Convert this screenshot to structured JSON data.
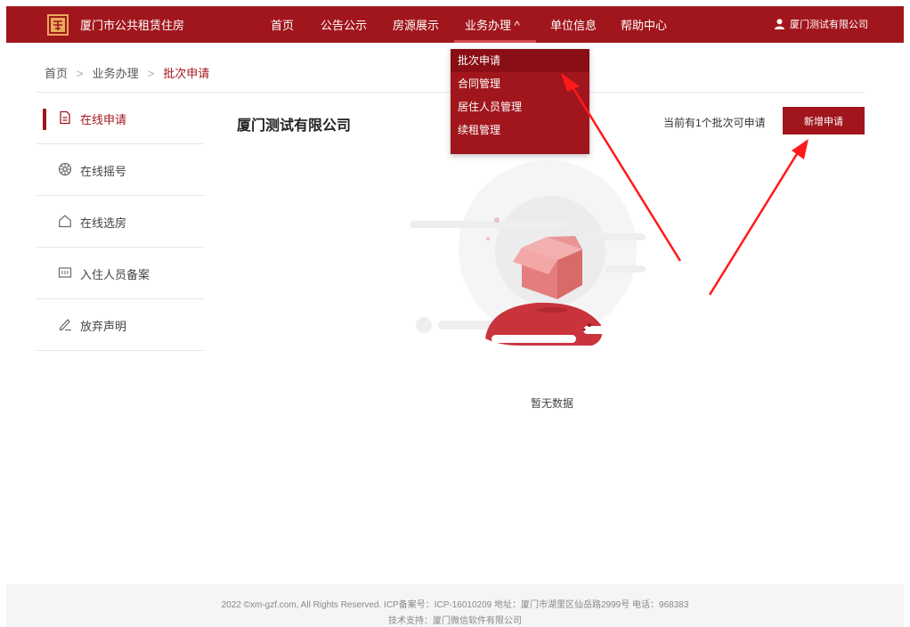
{
  "header": {
    "brand": "厦门市公共租赁住房",
    "nav": [
      {
        "label": "首页"
      },
      {
        "label": "公告公示"
      },
      {
        "label": "房源展示"
      },
      {
        "label": "业务办理 ^"
      },
      {
        "label": "单位信息"
      },
      {
        "label": "帮助中心"
      }
    ],
    "user": "厦门测试有限公司"
  },
  "dropdown": {
    "items": [
      {
        "label": "批次申请"
      },
      {
        "label": "合同管理"
      },
      {
        "label": "居住人员管理"
      },
      {
        "label": "续租管理"
      }
    ]
  },
  "breadcrumb": {
    "items": [
      "首页",
      "业务办理",
      "批次申请"
    ],
    "separator": ">"
  },
  "sidebar": {
    "items": [
      {
        "label": "在线申请",
        "icon": "document-icon"
      },
      {
        "label": "在线摇号",
        "icon": "lottery-wheel-icon"
      },
      {
        "label": "在线选房",
        "icon": "house-icon"
      },
      {
        "label": "入住人员备案",
        "icon": "id-card-icon"
      },
      {
        "label": "放弃声明",
        "icon": "pen-icon"
      }
    ]
  },
  "main": {
    "company": "厦门测试有限公司",
    "quota_text": "当前有1个批次可申请",
    "add_button": "新增申请",
    "empty_text": "暂无数据"
  },
  "footer": {
    "line1": "2022 ©xm-gzf.com, All Rights Reserved. ICP备案号：ICP-16010209 地址：厦门市湖里区仙岳路2999号 电话：968383",
    "line2": "技术支持：厦门微信软件有限公司"
  },
  "colors": {
    "primary": "#a1161d",
    "annotation_arrow": "#ff1a1a",
    "footer_bg": "#f5f5f5"
  }
}
